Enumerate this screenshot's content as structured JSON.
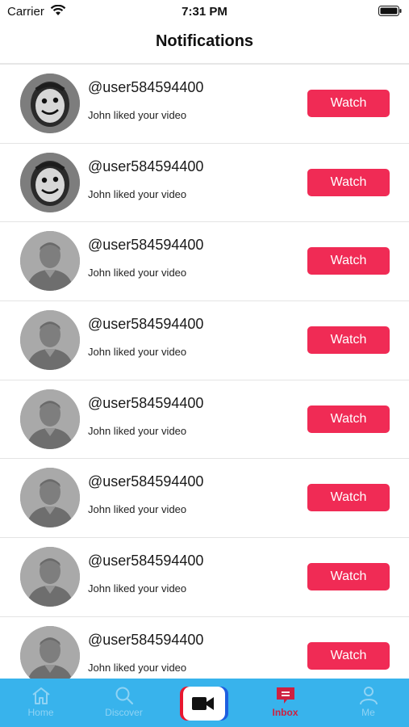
{
  "status_bar": {
    "carrier": "Carrier",
    "time": "7:31 PM"
  },
  "header": {
    "title": "Notifications"
  },
  "notifications": [
    {
      "username": "@user584594400",
      "message": "John liked your video",
      "action_label": "Watch",
      "avatar": "custom-photo-avatar"
    },
    {
      "username": "@user584594400",
      "message": "John liked your video",
      "action_label": "Watch",
      "avatar": "custom-photo-avatar"
    },
    {
      "username": "@user584594400",
      "message": "John liked your video",
      "action_label": "Watch",
      "avatar": "default-person-avatar"
    },
    {
      "username": "@user584594400",
      "message": "John liked your video",
      "action_label": "Watch",
      "avatar": "default-person-avatar"
    },
    {
      "username": "@user584594400",
      "message": "John liked your video",
      "action_label": "Watch",
      "avatar": "default-person-avatar"
    },
    {
      "username": "@user584594400",
      "message": "John liked your video",
      "action_label": "Watch",
      "avatar": "default-person-avatar"
    },
    {
      "username": "@user584594400",
      "message": "John liked your video",
      "action_label": "Watch",
      "avatar": "default-person-avatar"
    },
    {
      "username": "@user584594400",
      "message": "John liked your video",
      "action_label": "Watch",
      "avatar": "default-person-avatar"
    }
  ],
  "tab_bar": {
    "tabs": [
      {
        "label": "Home",
        "icon": "home-icon",
        "active": false
      },
      {
        "label": "Discover",
        "icon": "search-icon",
        "active": false
      },
      {
        "label": "",
        "icon": "video-camera-icon",
        "active": false
      },
      {
        "label": "Inbox",
        "icon": "inbox-icon",
        "active": true
      },
      {
        "label": "Me",
        "icon": "person-icon",
        "active": false
      }
    ]
  },
  "colors": {
    "accent": "#f02b55",
    "tab_bar_background": "#38b3ec",
    "active_tab": "#ce2040",
    "inactive_tab": "#8fd3f4"
  }
}
